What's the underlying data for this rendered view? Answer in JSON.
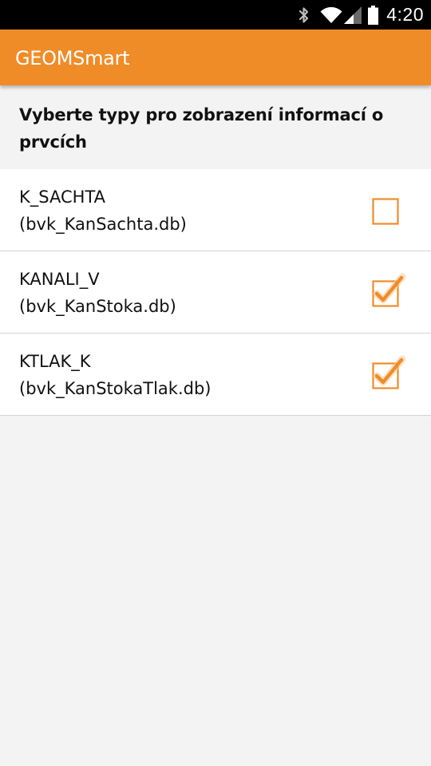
{
  "status_bar": {
    "time": "4:20",
    "icons": [
      "bluetooth-icon",
      "wifi-icon",
      "signal-icon",
      "battery-icon"
    ]
  },
  "app_bar": {
    "title": "GEOMSmart"
  },
  "header": {
    "text": "Vyberte typy pro zobrazení informací o prvcích"
  },
  "items": [
    {
      "name": "K_SACHTA",
      "db": "(bvk_KanSachta.db)",
      "checked": false
    },
    {
      "name": "KANALI_V",
      "db": "(bvk_KanStoka.db)",
      "checked": true
    },
    {
      "name": "KTLAK_K",
      "db": "(bvk_KanStokaTlak.db)",
      "checked": true
    }
  ],
  "colors": {
    "accent": "#f08c28",
    "checkbox": "#f08c28",
    "background": "#f3f3f3",
    "status_bar": "#000000"
  }
}
